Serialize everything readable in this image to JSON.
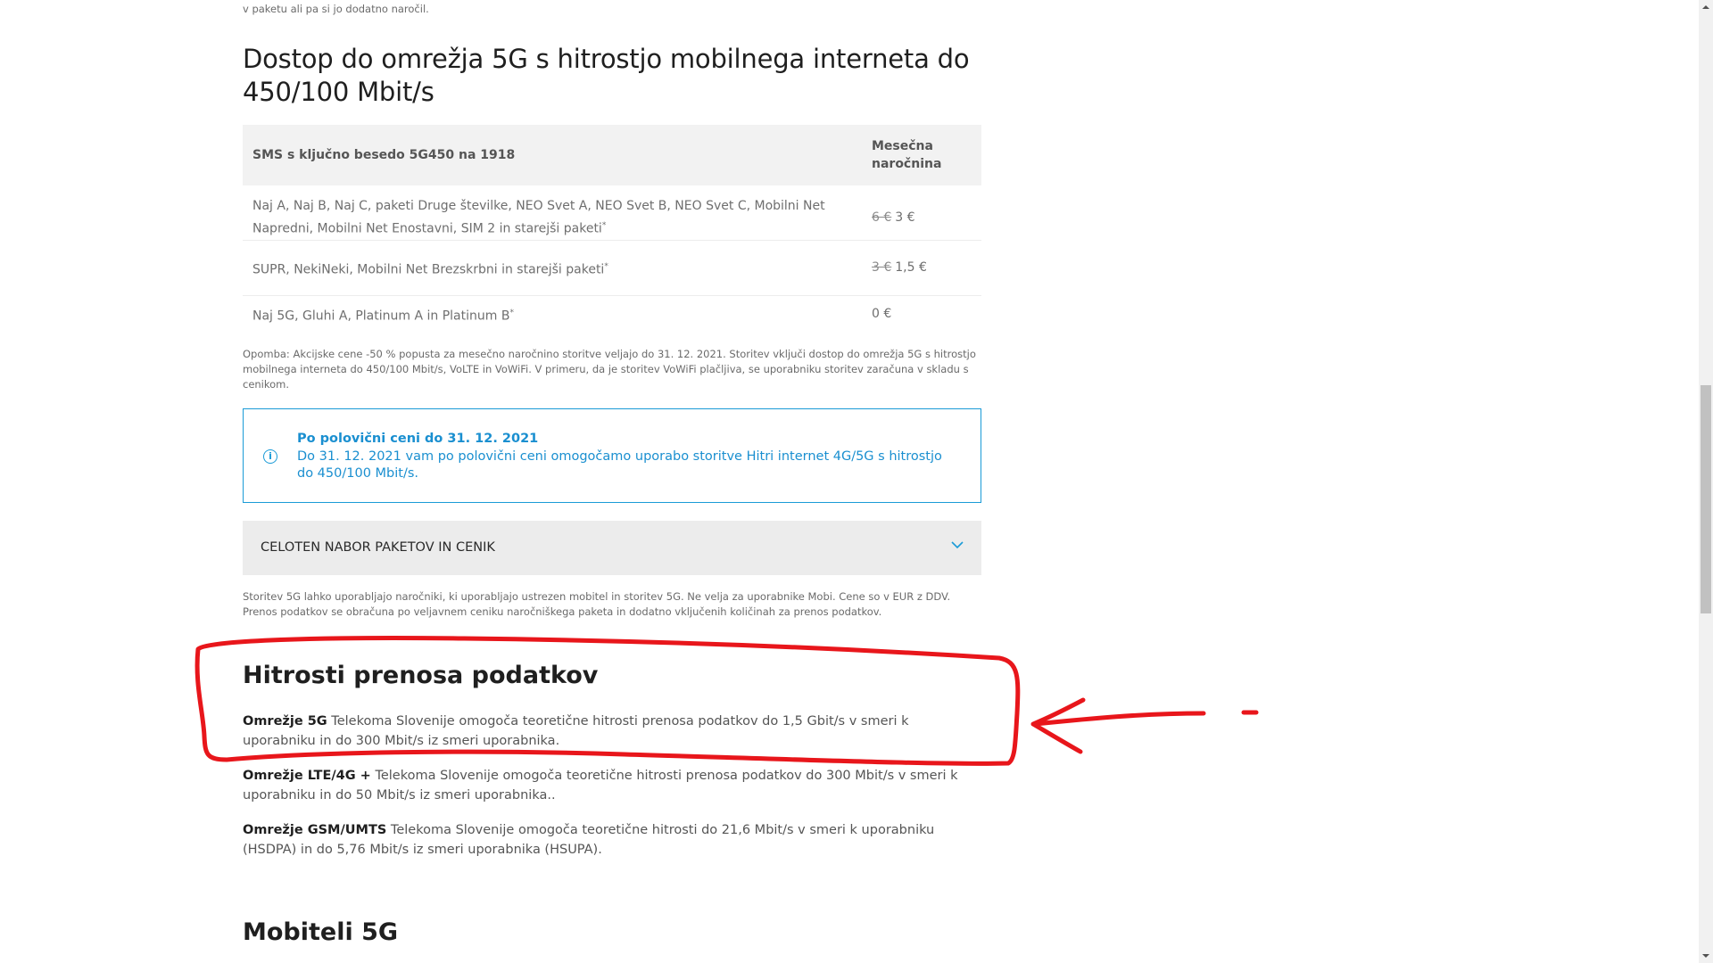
{
  "top_text": "v paketu ali pa si jo dodatno naročil.",
  "section_5g": {
    "title": "Dostop do omrežja 5G s hitrostjo mobilnega interneta do 450/100 Mbit/s",
    "table": {
      "header_col1": "SMS s ključno besedo 5G450 na 1918",
      "header_col2": "Mesečna naročnina",
      "rows": [
        {
          "packages": "Naj A, Naj B, Naj C, paketi Druge številke, NEO Svet A, NEO Svet B, NEO Svet C, Mobilni Net Napredni, Mobilni Net Enostavni, SIM 2 in starejši paketi",
          "marker": "*",
          "old_price": "6 €",
          "price": "3 €"
        },
        {
          "packages": "SUPR, NekiNeki, Mobilni Net Brezskrbni in starejši paketi",
          "marker": "*",
          "old_price": "3 €",
          "price": "1,5 €"
        },
        {
          "packages": "Naj 5G, Gluhi A, Platinum A in Platinum B",
          "marker": "*",
          "old_price": "",
          "price": "0 €"
        }
      ]
    },
    "note": "Opomba: Akcijske cene -50 % popusta za mesečno naročnino storitve veljajo do 31. 12. 2021. Storitev vključi dostop do omrežja 5G s hitrostjo mobilnega interneta do 450/100 Mbit/s, VoLTE in VoWiFi. V primeru, da je storitev VoWiFi plačljiva, se uporabniku storitev zaračuna v skladu s cenikom."
  },
  "info_box": {
    "title": "Po polovični ceni do 31. 12. 2021",
    "text": "Do 31. 12. 2021 vam po polovični ceni omogočamo uporabo storitve Hitri internet 4G/5G s hitrostjo do 450/100 Mbit/s.",
    "icon": "info-icon",
    "accent_color": "#1a9bd7"
  },
  "accordion": {
    "label": "CELOTEN NABOR PAKETOV IN CENIK",
    "icon": "chevron-down-icon"
  },
  "footnote_5g": "Storitev 5G lahko uporabljajo naročniki, ki uporabljajo ustrezen mobitel in storitev 5G. Ne velja za uporabnike Mobi. Cene so v EUR z DDV. Prenos podatkov se obračuna po veljavnem ceniku naročniškega paketa in dodatno vključenih količinah za prenos podatkov.",
  "speeds_section": {
    "title": "Hitrosti prenosa podatkov",
    "items": [
      {
        "bold": "Omrežje 5G",
        "text": " Telekoma Slovenije omogoča teoretične hitrosti prenosa podatkov do 1,5 Gbit/s v smeri k uporabniku in do 300 Mbit/s iz smeri uporabnika."
      },
      {
        "bold": "Omrežje LTE/4G +",
        "text": " Telekoma Slovenije omogoča teoretične hitrosti prenosa podatkov do 300 Mbit/s v smeri k uporabniku in do 50 Mbit/s iz smeri uporabnika.."
      },
      {
        "bold": "Omrežje GSM/UMTS",
        "text": " Telekoma Slovenije omogoča teoretične hitrosti do 21,6 Mbit/s v smeri k uporabniku (HSDPA) in do 5,76 Mbit/s iz smeri uporabnika (HSUPA)."
      }
    ]
  },
  "mobiteli_title": "Mobiteli 5G",
  "annotation": {
    "color": "#e8161b"
  }
}
